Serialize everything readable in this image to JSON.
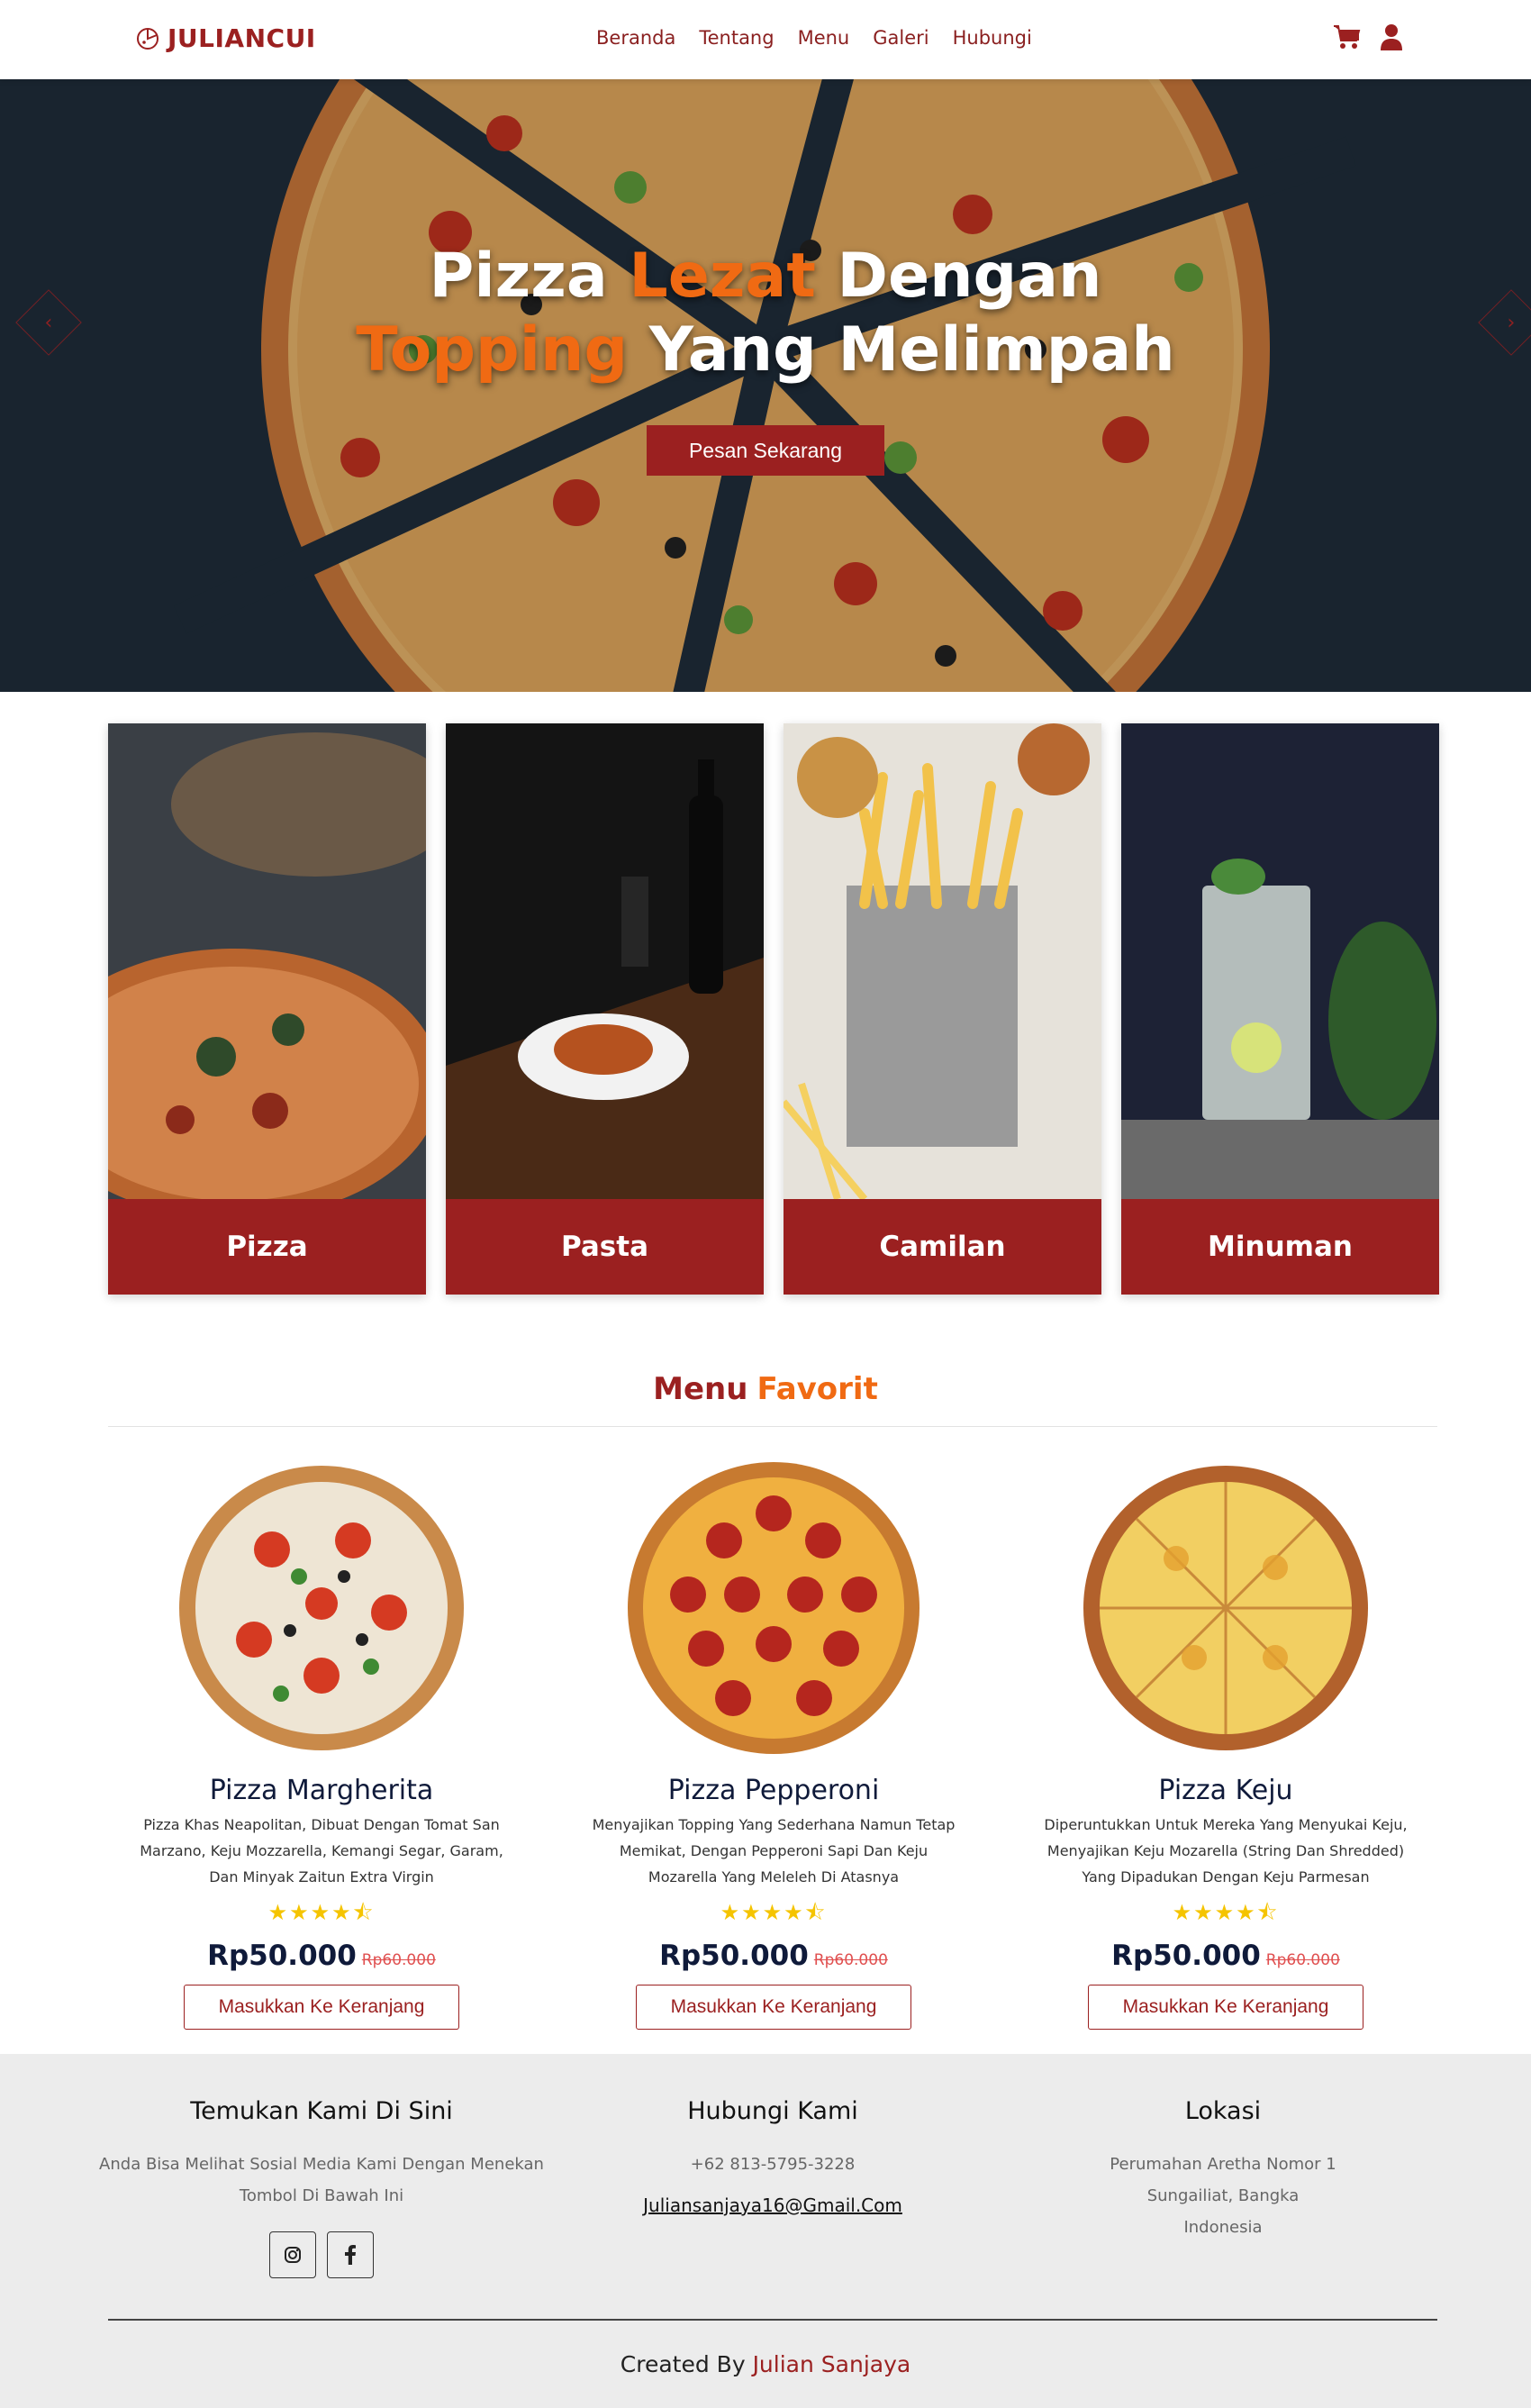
{
  "nav": {
    "brand": "JULIANCUI",
    "links": [
      "Beranda",
      "Tentang",
      "Menu",
      "Galeri",
      "Hubungi"
    ],
    "icons": [
      "cart-icon",
      "user-icon"
    ],
    "accent_color": "#9b2020"
  },
  "hero": {
    "title_line1_a": "Pizza ",
    "title_line1_accent": "Lezat",
    "title_line1_b": " Dengan",
    "title_line2_accent": "Topping",
    "title_line2_b": " Yang Melimpah",
    "cta": "Pesan Sekarang",
    "accent_color": "#f06a13"
  },
  "categories": [
    {
      "label": "Pizza"
    },
    {
      "label": "Pasta"
    },
    {
      "label": "Camilan"
    },
    {
      "label": "Minuman"
    }
  ],
  "favorites": {
    "title_a": "Menu",
    "title_b": "Favorit",
    "products": [
      {
        "name": "Pizza Margherita",
        "description": "Pizza Khas Neapolitan, Dibuat Dengan Tomat San Marzano, Keju Mozzarella, Kemangi Segar, Garam, Dan Minyak Zaitun Extra Virgin",
        "rating": 4.5,
        "stars": "★★★★⯪",
        "price": "Rp50.000",
        "old_price": "Rp60.000",
        "button": "Masukkan Ke Keranjang"
      },
      {
        "name": "Pizza Pepperoni",
        "description": "Menyajikan Topping Yang Sederhana Namun Tetap Memikat, Dengan Pepperoni Sapi Dan Keju Mozarella Yang Meleleh Di Atasnya",
        "rating": 4.5,
        "stars": "★★★★⯪",
        "price": "Rp50.000",
        "old_price": "Rp60.000",
        "button": "Masukkan Ke Keranjang"
      },
      {
        "name": "Pizza Keju",
        "description": "Diperuntukkan Untuk Mereka Yang Menyukai Keju, Menyajikan Keju Mozarella (String Dan Shredded) Yang Dipadukan Dengan Keju Parmesan",
        "rating": 4.5,
        "stars": "★★★★⯪",
        "price": "Rp50.000",
        "old_price": "Rp60.000",
        "button": "Masukkan Ke Keranjang"
      }
    ]
  },
  "footer": {
    "social": {
      "title": "Temukan Kami Di Sini",
      "text": "Anda Bisa Melihat Sosial Media Kami Dengan Menekan Tombol Di Bawah Ini",
      "buttons": [
        "instagram-icon",
        "facebook-icon"
      ]
    },
    "contact": {
      "title": "Hubungi Kami",
      "phone": "+62 813-5795-3228",
      "email": "Juliansanjaya16@Gmail.Com"
    },
    "location": {
      "title": "Lokasi",
      "line1": "Perumahan Aretha Nomor 1",
      "line2": "Sungailiat, Bangka",
      "line3": "Indonesia"
    },
    "credit_prefix": "Created By ",
    "credit_author": "Julian Sanjaya"
  }
}
